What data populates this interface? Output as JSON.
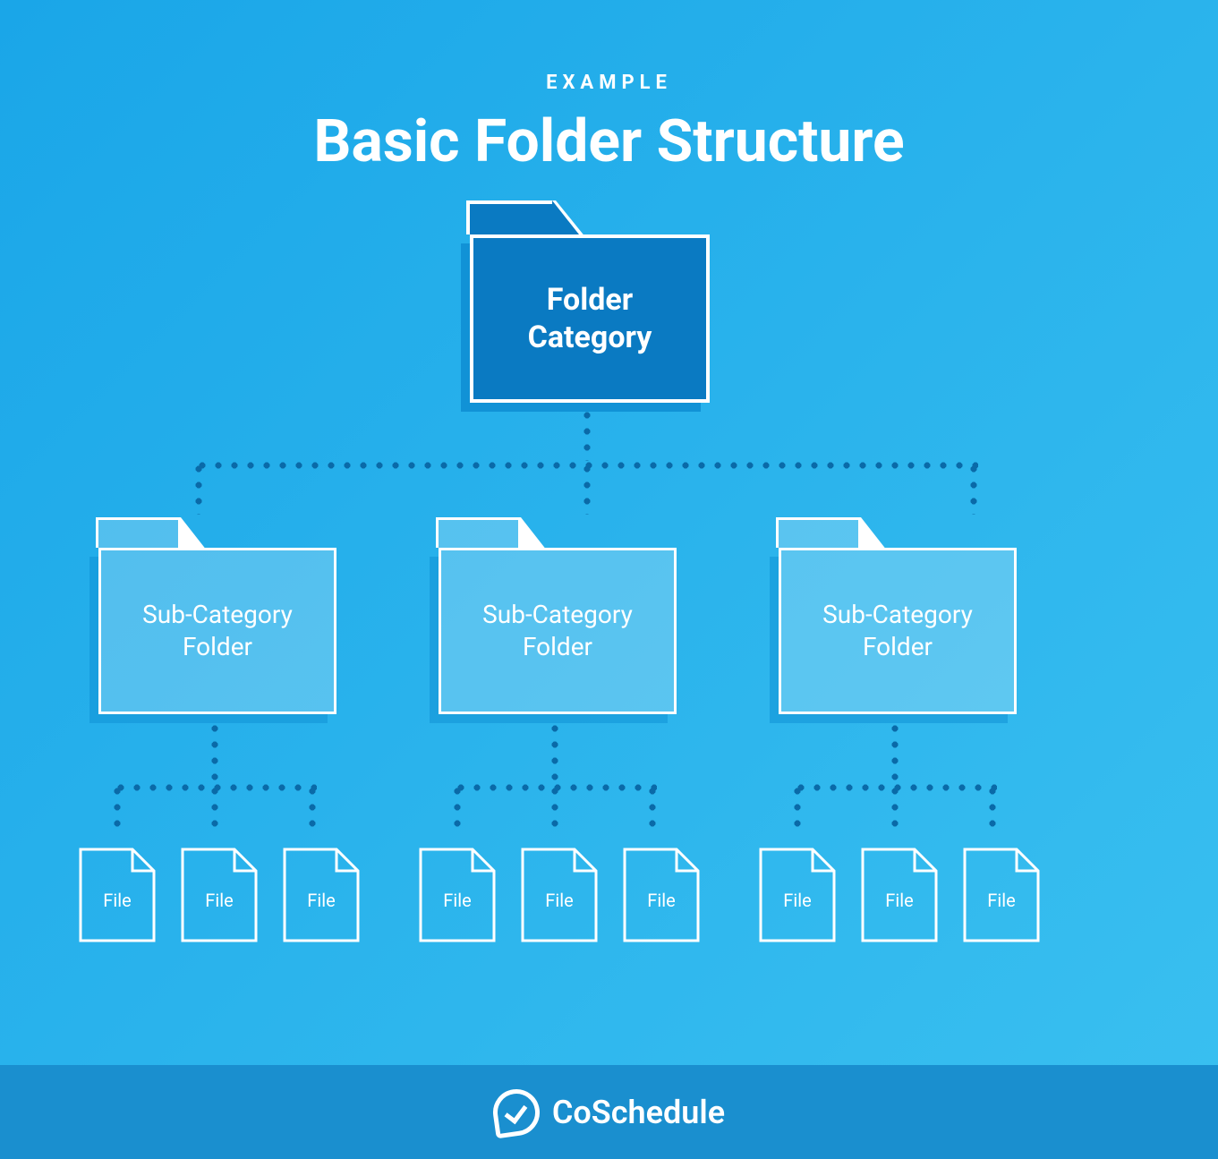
{
  "header": {
    "eyebrow": "EXAMPLE",
    "title": "Basic Folder Structure"
  },
  "root_folder": {
    "label": "Folder\nCategory"
  },
  "sub_folders": [
    {
      "label": "Sub-Category\nFolder"
    },
    {
      "label": "Sub-Category\nFolder"
    },
    {
      "label": "Sub-Category\nFolder"
    }
  ],
  "file_label": "File",
  "brand": "CoSchedule",
  "colors": {
    "bg_top": "#1aa6e8",
    "bg_bottom": "#3ac0f0",
    "root_folder": "#0a7ac2",
    "dot": "#0a6aa8",
    "footer": "#1a8fcf"
  }
}
